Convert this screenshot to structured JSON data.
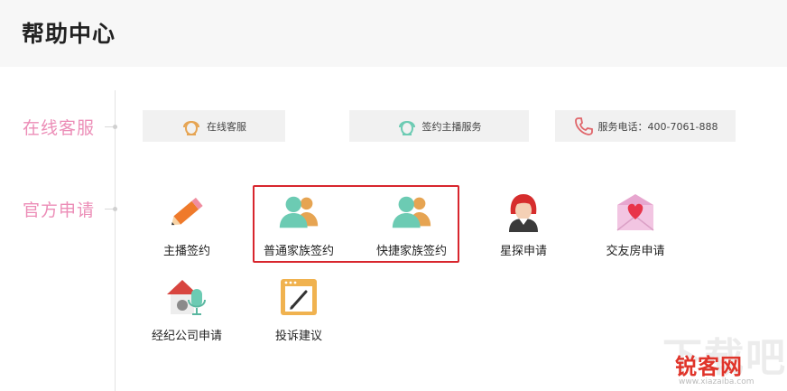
{
  "header": {
    "title": "帮助中心"
  },
  "sections": {
    "online_service": "在线客服",
    "official_apply": "官方申请"
  },
  "service_buttons": [
    {
      "label": "在线客服",
      "icon": "headset-icon"
    },
    {
      "label": "签约主播服务",
      "icon": "headset-icon"
    },
    {
      "label": "服务电话：400-7061-888",
      "icon": "phone-icon"
    }
  ],
  "apps": [
    {
      "label": "主播签约",
      "icon": "pencil-icon"
    },
    {
      "label": "普通家族签约",
      "icon": "family-icon"
    },
    {
      "label": "快捷家族签约",
      "icon": "family-icon"
    },
    {
      "label": "星探申请",
      "icon": "scout-icon"
    },
    {
      "label": "交友房申请",
      "icon": "love-letter-icon"
    },
    {
      "label": "经纪公司申请",
      "icon": "agency-mic-icon"
    },
    {
      "label": "投诉建议",
      "icon": "feedback-icon"
    }
  ],
  "watermark": {
    "brand": "锐客网",
    "big": "下载吧",
    "url": "www.xiazaiba.com"
  },
  "colors": {
    "accent_pink": "#ec8db7",
    "highlight_red": "#d8262e",
    "teal": "#6ccbb3",
    "orange": "#e6a452"
  }
}
